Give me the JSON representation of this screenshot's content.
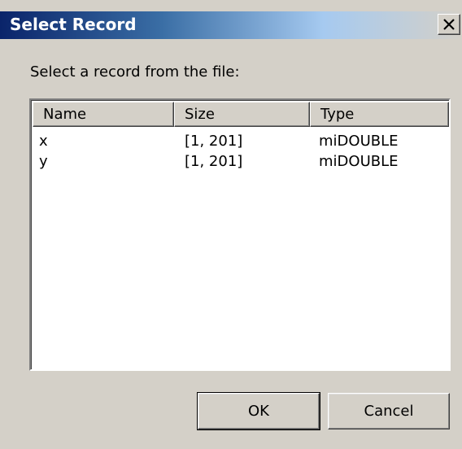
{
  "window": {
    "title": "Select Record",
    "close_icon": "close-icon"
  },
  "prompt": "Select a record from the file:",
  "table": {
    "columns": [
      "Name",
      "Size",
      "Type"
    ],
    "rows": [
      {
        "name": "x",
        "size": "[1, 201]",
        "type": "miDOUBLE"
      },
      {
        "name": "y",
        "size": "[1, 201]",
        "type": "miDOUBLE"
      }
    ]
  },
  "buttons": {
    "ok_label": "OK",
    "cancel_label": "Cancel"
  },
  "colors": {
    "title_bar_start": "#0a246a",
    "title_bar_end": "#d4d0c8",
    "dialog_face": "#d4d0c8",
    "list_background": "#ffffff"
  }
}
